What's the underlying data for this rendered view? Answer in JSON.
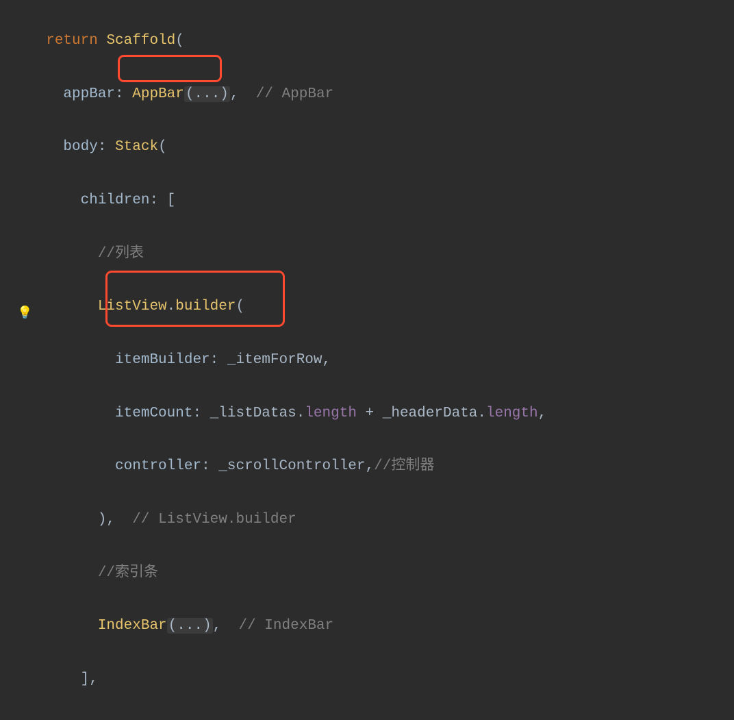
{
  "code": {
    "l1": {
      "kw_return": "return",
      "type_scaffold": "Scaffold",
      "paren_open": "("
    },
    "l2": {
      "param_appbar": "appBar",
      "colon": ": ",
      "type_appbar": "AppBar",
      "fold": "(...)",
      "comma": ",",
      "comment": "// AppBar"
    },
    "l3": {
      "param_body": "body",
      "colon": ": ",
      "type_stack": "Stack",
      "paren_open": "("
    },
    "l4": {
      "param_children": "children",
      "colon": ": ",
      "bracket": "["
    },
    "l5": {
      "comment": "//列表"
    },
    "l6": {
      "type_listview": "ListView",
      "dot": ".",
      "builder": "builder",
      "paren_open": "("
    },
    "l7": {
      "param_ib": "itemBuilder",
      "colon": ": ",
      "val": "_itemForRow",
      "comma": ","
    },
    "l8": {
      "param_ic": "itemCount",
      "colon": ": ",
      "a": "_listDatas",
      "dot1": ".",
      "len1": "length",
      "plus": " + ",
      "b": "_headerData",
      "dot2": ".",
      "len2": "length",
      "comma": ","
    },
    "l9": {
      "param_ctrl": "controller",
      "colon": ": ",
      "val": "_scrollController",
      "comma": ",",
      "comment": "//控制器"
    },
    "l10": {
      "close": "),",
      "comment": "// ListView.builder"
    },
    "l11": {
      "comment": "//索引条"
    },
    "l12": {
      "type_indexbar": "IndexBar",
      "fold": "(...)",
      "comma": ",",
      "comment": "// IndexBar"
    },
    "l13": {
      "bracket": "],"
    }
  },
  "gutter": {
    "bulb": "💡"
  },
  "highlights": {
    "h1": "Stack(",
    "h2": "IndexBar(...)",
    "h2b": "//索引条"
  }
}
